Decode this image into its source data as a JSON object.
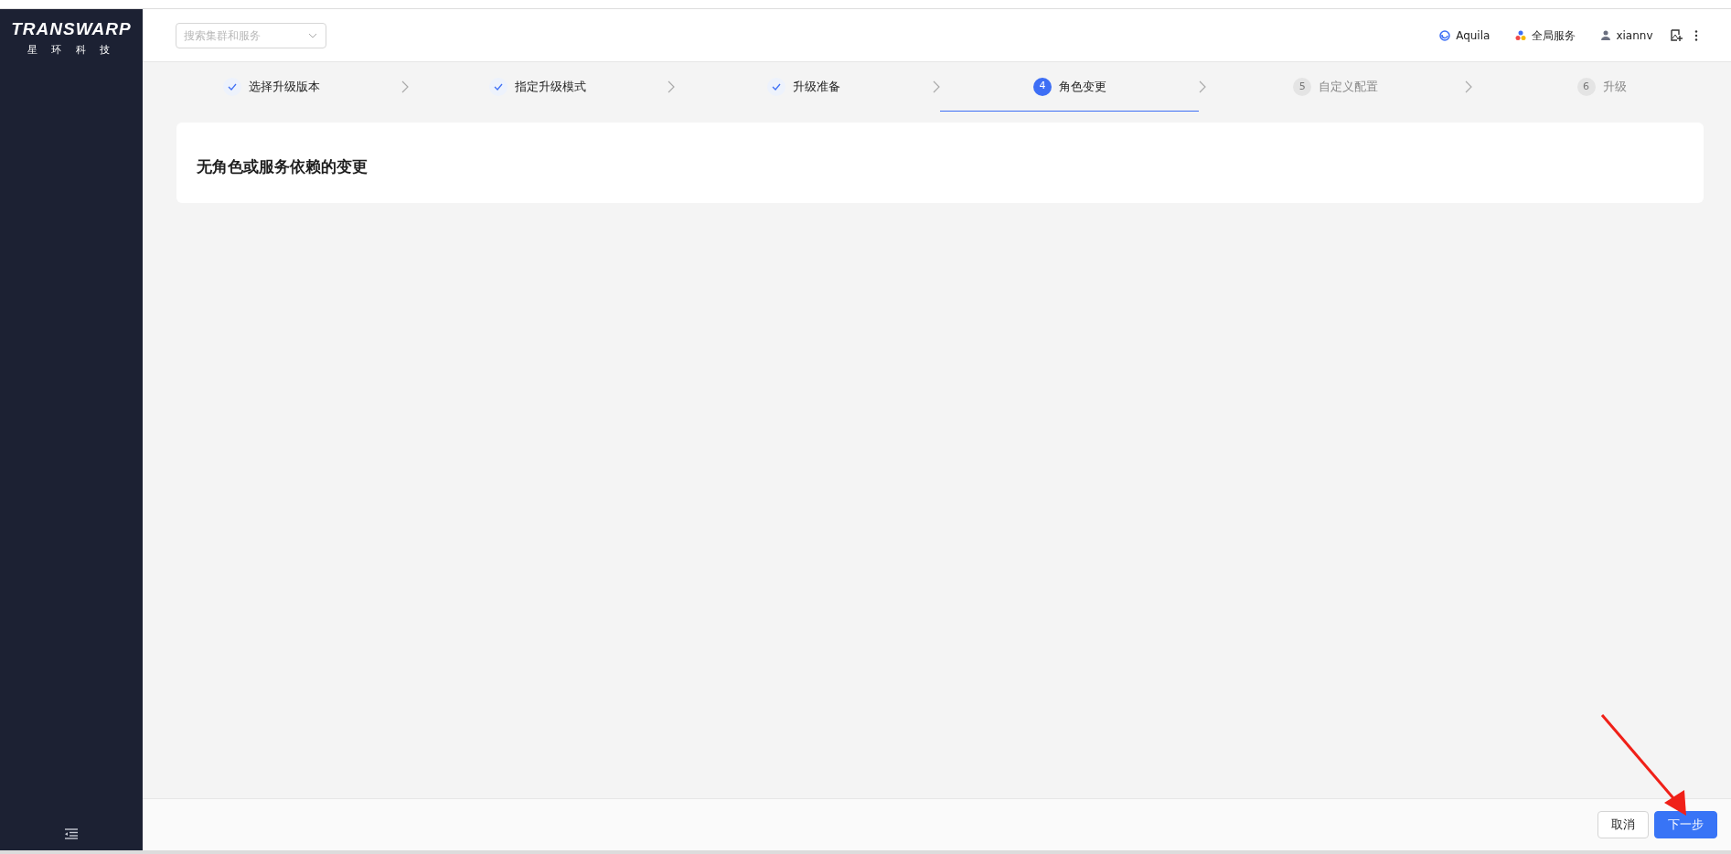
{
  "logo": {
    "wordmark": "TRANSWARP",
    "subtitle": "星 环 科 技"
  },
  "header": {
    "search": {
      "placeholder": "搜索集群和服务"
    },
    "links": [
      {
        "kind": "product",
        "label": "Aquila"
      },
      {
        "kind": "services",
        "label": "全局服务"
      },
      {
        "kind": "user",
        "label": "xiannv"
      }
    ]
  },
  "steps": [
    {
      "label": "选择升级版本",
      "completed": true,
      "selected": false
    },
    {
      "label": "指定升级模式",
      "completed": true,
      "selected": false
    },
    {
      "label": "升级准备",
      "completed": true,
      "selected": false
    },
    {
      "number": "4",
      "label": "角色变更",
      "completed": false,
      "selected": true
    },
    {
      "number": "5",
      "label": "自定义配置",
      "completed": false,
      "selected": false
    },
    {
      "number": "6",
      "label": "升级",
      "completed": false,
      "selected": false
    }
  ],
  "card": {
    "title": "无角色或服务依赖的变更"
  },
  "footer": {
    "buttons": [
      {
        "kind": "secondary",
        "label": "取消"
      },
      {
        "kind": "primary",
        "label": "下一步"
      }
    ]
  }
}
